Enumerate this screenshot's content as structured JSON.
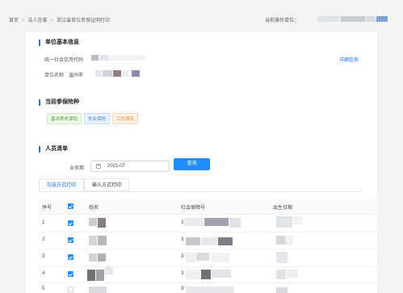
{
  "breadcrumb": {
    "home": "首页",
    "section": "法人办事",
    "current": "浙江省单位参保证明打印"
  },
  "operator_label": "当前操作单位：",
  "basic_info": {
    "title": "单位基本信息",
    "credit_code_label": "统一社会信用代码",
    "unit_name_label": "单位名称",
    "unit_name_value": "温州市",
    "detail_link": "详细信息"
  },
  "insurance": {
    "title": "当前参保险种",
    "tags": [
      "基本养老保险",
      "失业保险",
      "工伤保险"
    ]
  },
  "personnel": {
    "title": "人员清单",
    "period_label": "业务期",
    "period_value": "2021-07",
    "query_button": "查询",
    "tabs": [
      "勾选方式打印",
      "输入方式打印"
    ],
    "columns": [
      "序号",
      "姓名",
      "社会保障号",
      "出生日期"
    ],
    "rows": [
      {
        "no": "1",
        "checked": true,
        "ssn_prefix": "3"
      },
      {
        "no": "2",
        "checked": true,
        "ssn_prefix": "3"
      },
      {
        "no": "3",
        "checked": true,
        "ssn_prefix": "3"
      },
      {
        "no": "4",
        "checked": true,
        "ssn_prefix": "3"
      },
      {
        "no": "5",
        "checked": false,
        "ssn_prefix": "3"
      }
    ]
  },
  "colors": {
    "accent": "#1f8efa",
    "title_bar": "#1a73e8"
  },
  "icons": [
    "calendar-icon",
    "checkbox-checked-icon",
    "checkbox-header-icon"
  ]
}
